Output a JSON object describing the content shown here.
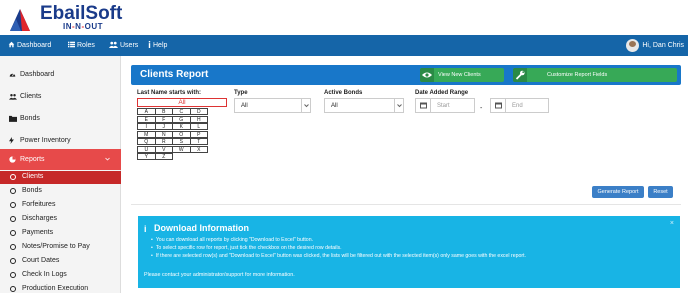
{
  "logo": {
    "brand": "EbailSoft",
    "sub_prefix": "IN",
    "sub_sep1": "-",
    "sub_mid": "N",
    "sub_sep2": "-",
    "sub_suffix": "OUT"
  },
  "topnav": {
    "items": [
      {
        "label": "Dashboard",
        "icon": "home-icon"
      },
      {
        "label": "Roles",
        "icon": "list-icon"
      },
      {
        "label": "Users",
        "icon": "users-icon"
      },
      {
        "label": "Help",
        "icon": "info-icon"
      }
    ],
    "user_greeting": "Hi, Dan Chris"
  },
  "sidebar": {
    "items": [
      {
        "label": "Dashboard",
        "icon": "dashboard-icon"
      },
      {
        "label": "Clients",
        "icon": "users-icon"
      },
      {
        "label": "Bonds",
        "icon": "folder-icon"
      },
      {
        "label": "Power Inventory",
        "icon": "bolt-icon"
      },
      {
        "label": "Reports",
        "icon": "pie-chart-icon",
        "active": true
      }
    ],
    "report_subitems": [
      "Clients",
      "Bonds",
      "Forfeitures",
      "Discharges",
      "Payments",
      "Notes/Promise to Pay",
      "Court Dates",
      "Check In Logs",
      "Production Execution"
    ],
    "active_subitem": "Clients"
  },
  "report": {
    "title": "Clients Report",
    "view_new_clients": "View New Clients",
    "customize_fields": "Customize Report Fields"
  },
  "filters": {
    "last_name_label": "Last Name starts with:",
    "all_label": "All",
    "letters": [
      "A",
      "B",
      "C",
      "D",
      "E",
      "F",
      "G",
      "H",
      "I",
      "J",
      "K",
      "L",
      "M",
      "N",
      "O",
      "P",
      "Q",
      "R",
      "S",
      "T",
      "U",
      "V",
      "W",
      "X",
      "Y",
      "Z"
    ],
    "type_label": "Type",
    "type_value": "All",
    "active_bonds_label": "Active Bonds",
    "active_bonds_value": "All",
    "date_range_label": "Date Added Range",
    "start_placeholder": "Start",
    "range_separator": "-",
    "end_placeholder": "End"
  },
  "actions": {
    "generate": "Generate Report",
    "reset": "Reset"
  },
  "download": {
    "title": "Download Information",
    "bullets": [
      "You can download all reports by clicking \"Download to Excel\" button.",
      "To select specific row for report, just tick the checkbox on the desired row details.",
      "If there are selected row(s) and \"Download to Excel\" button was clicked, the lists will be filtered out with the selected item(s) only same goes with the excel report."
    ],
    "contact": "Please contact your administrator/support for more information.",
    "close": "×"
  },
  "colors": {
    "nav_blue": "#1565a8",
    "header_blue": "#1877c9",
    "reports_red": "#e74a4a",
    "active_sub_red": "#c62828",
    "green_button": "#37a957",
    "info_cyan": "#18b4e5",
    "brand_navy": "#1a3b8a"
  }
}
